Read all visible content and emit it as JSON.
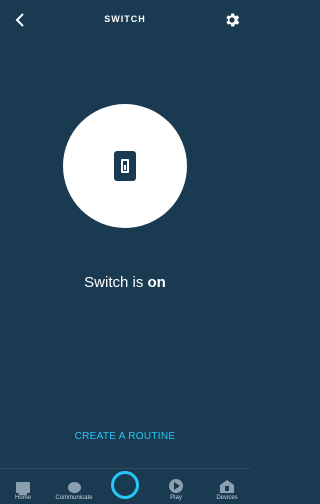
{
  "header": {
    "title": "SWITCH",
    "back_icon": "chevron-left-icon",
    "settings_icon": "gear-icon"
  },
  "device": {
    "icon": "light-switch-icon",
    "status_prefix": "Switch is",
    "status_value": "on"
  },
  "actions": {
    "create_routine": "CREATE A ROUTINE"
  },
  "nav": {
    "home": "Home",
    "communicate": "Communicate",
    "alexa": "alexa-ring-icon",
    "play": "Play",
    "devices": "Devices"
  },
  "colors": {
    "background": "#1a3a52",
    "accent": "#26c6f6",
    "circle": "#ffffff"
  }
}
